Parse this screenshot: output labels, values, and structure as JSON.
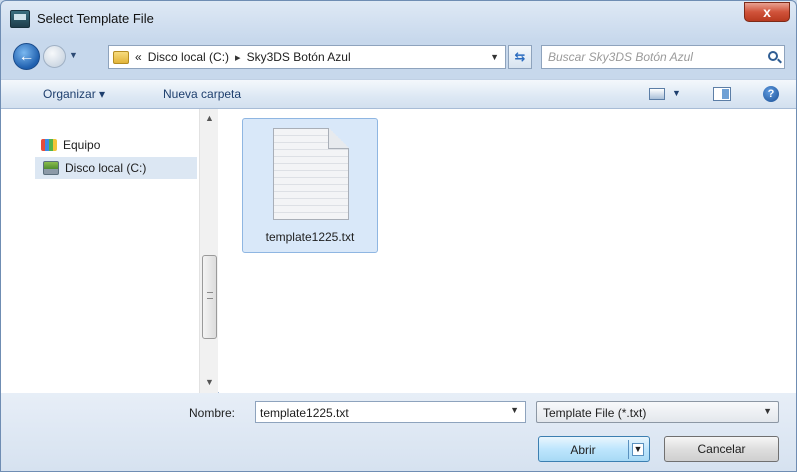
{
  "window": {
    "title": "Select Template File",
    "close_label": "x"
  },
  "address_bar": {
    "history_prefix": "«",
    "path": [
      "Disco local (C:)",
      "Sky3DS Botón Azul"
    ],
    "separator": "▸",
    "search_placeholder": "Buscar Sky3DS Botón Azul"
  },
  "toolbar": {
    "organize_label": "Organizar ▾",
    "new_folder_label": "Nueva carpeta",
    "help_label": "?"
  },
  "nav_pane": {
    "items": [
      {
        "label": "Equipo",
        "icon": "computer-icon"
      },
      {
        "label": "Disco local (C:)",
        "icon": "drive-icon",
        "selected": true
      }
    ]
  },
  "files": [
    {
      "name": "template1225.txt",
      "icon": "text-file-icon",
      "selected": true
    }
  ],
  "footer": {
    "name_label": "Nombre:",
    "name_value": "template1225.txt",
    "filter_value": "Template File (*.txt)",
    "open_label": "Abrir",
    "cancel_label": "Cancelar"
  }
}
